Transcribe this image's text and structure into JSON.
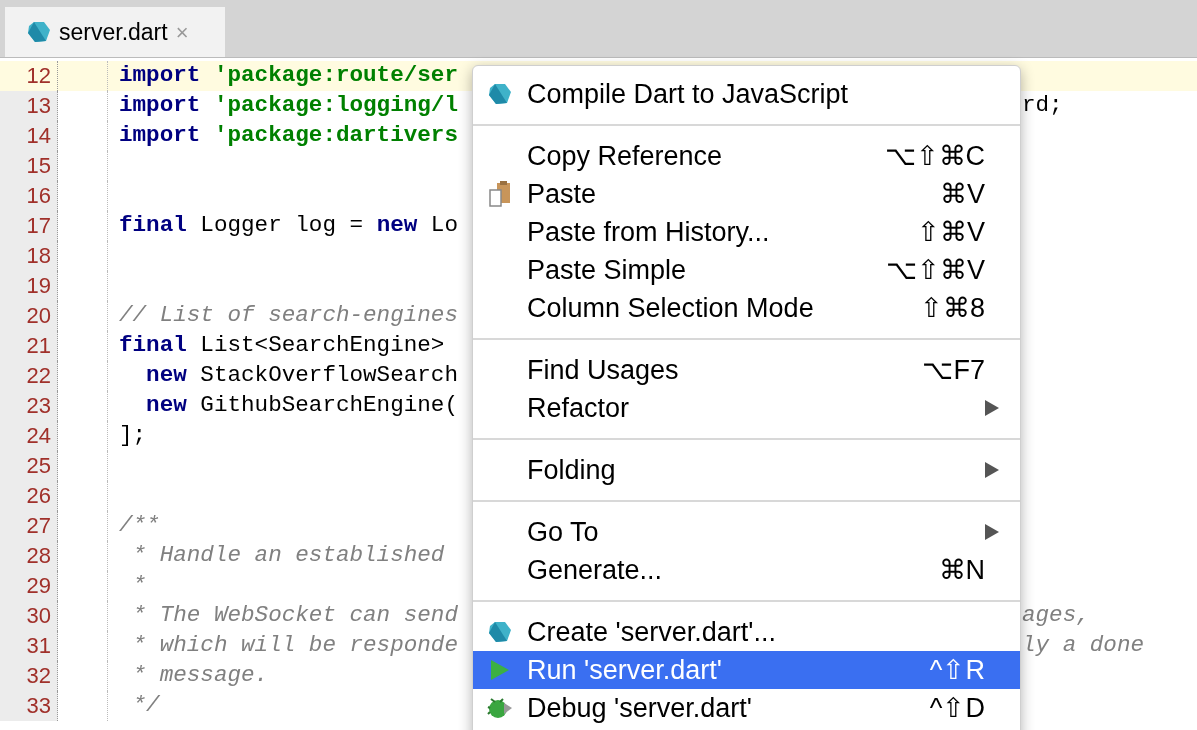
{
  "tabs": [
    {
      "label": "server.dart",
      "close": "×",
      "selected": true
    }
  ],
  "code": [
    {
      "number": "12",
      "current": true,
      "tokens": [
        {
          "kind": "keyword",
          "text": "import"
        },
        {
          "kind": "string",
          "text": " 'package:route/ser"
        }
      ]
    },
    {
      "number": "13",
      "current": false,
      "tokens": [
        {
          "kind": "keyword",
          "text": "import"
        },
        {
          "kind": "string",
          "text": " 'package:logging/l"
        }
      ],
      "right": [
        {
          "kind": "plain",
          "text": "rd;"
        }
      ]
    },
    {
      "number": "14",
      "current": false,
      "tokens": [
        {
          "kind": "keyword",
          "text": "import"
        },
        {
          "kind": "string",
          "text": " 'package:dartivers"
        }
      ]
    },
    {
      "number": "15",
      "current": false
    },
    {
      "number": "16",
      "current": false
    },
    {
      "number": "17",
      "current": false,
      "tokens": [
        {
          "kind": "keyword",
          "text": "final"
        },
        {
          "kind": "plain",
          "text": " Logger log = "
        },
        {
          "kind": "keyword",
          "text": "new"
        },
        {
          "kind": "plain",
          "text": " Lo"
        }
      ]
    },
    {
      "number": "18",
      "current": false
    },
    {
      "number": "19",
      "current": false
    },
    {
      "number": "20",
      "current": false,
      "tokens": [
        {
          "kind": "comment",
          "text": "// List of search-engines"
        }
      ]
    },
    {
      "number": "21",
      "current": false,
      "tokens": [
        {
          "kind": "keyword",
          "text": "final"
        },
        {
          "kind": "plain",
          "text": " List<SearchEngine>"
        }
      ]
    },
    {
      "number": "22",
      "current": false,
      "tokens": [
        {
          "kind": "keyword",
          "text": "  new"
        },
        {
          "kind": "plain",
          "text": " StackOverflowSearch"
        }
      ]
    },
    {
      "number": "23",
      "current": false,
      "tokens": [
        {
          "kind": "keyword",
          "text": "  new"
        },
        {
          "kind": "plain",
          "text": " GithubSearchEngine("
        }
      ]
    },
    {
      "number": "24",
      "current": false,
      "tokens": [
        {
          "kind": "plain",
          "text": "];"
        }
      ]
    },
    {
      "number": "25",
      "current": false
    },
    {
      "number": "26",
      "current": false
    },
    {
      "number": "27",
      "current": false,
      "tokens": [
        {
          "kind": "comment",
          "text": "/**"
        }
      ]
    },
    {
      "number": "28",
      "current": false,
      "tokens": [
        {
          "kind": "comment",
          "text": " * Handle an established"
        }
      ]
    },
    {
      "number": "29",
      "current": false,
      "tokens": [
        {
          "kind": "comment",
          "text": " *"
        }
      ]
    },
    {
      "number": "30",
      "current": false,
      "tokens": [
        {
          "kind": "comment",
          "text": " * The WebSocket can send"
        }
      ],
      "right": [
        {
          "kind": "comment",
          "text": "ages,"
        }
      ]
    },
    {
      "number": "31",
      "current": false,
      "tokens": [
        {
          "kind": "comment",
          "text": " * which will be responde"
        }
      ],
      "right": [
        {
          "kind": "comment",
          "text": "ly a done"
        }
      ]
    },
    {
      "number": "32",
      "current": false,
      "tokens": [
        {
          "kind": "comment",
          "text": " * message."
        }
      ]
    },
    {
      "number": "33",
      "current": false,
      "tokens": [
        {
          "kind": "comment",
          "text": " */"
        }
      ]
    }
  ],
  "context_menu": [
    {
      "kind": "dart",
      "label": "Compile Dart to JavaScript",
      "submenu": false,
      "selected": false
    },
    {
      "kind": "separator"
    },
    {
      "kind": "plain",
      "label": "Copy Reference",
      "shortcut": "⌥⇧⌘C",
      "submenu": false,
      "selected": false
    },
    {
      "kind": "paste",
      "label": "Paste",
      "shortcut": "⌘V",
      "submenu": false,
      "selected": false
    },
    {
      "kind": "plain",
      "label": "Paste from History...",
      "shortcut": "⇧⌘V",
      "submenu": false,
      "selected": false
    },
    {
      "kind": "plain",
      "label": "Paste Simple",
      "shortcut": "⌥⇧⌘V",
      "submenu": false,
      "selected": false
    },
    {
      "kind": "plain",
      "label": "Column Selection Mode",
      "shortcut": "⇧⌘8",
      "submenu": false,
      "selected": false
    },
    {
      "kind": "separator"
    },
    {
      "kind": "plain",
      "label": "Find Usages",
      "shortcut": "⌥F7",
      "submenu": false,
      "selected": false
    },
    {
      "kind": "plain",
      "label": "Refactor",
      "submenu": true,
      "selected": false
    },
    {
      "kind": "separator"
    },
    {
      "kind": "plain",
      "label": "Folding",
      "submenu": true,
      "selected": false
    },
    {
      "kind": "separator"
    },
    {
      "kind": "plain",
      "label": "Go To",
      "submenu": true,
      "selected": false
    },
    {
      "kind": "plain",
      "label": "Generate...",
      "shortcut": "⌘N",
      "submenu": false,
      "selected": false
    },
    {
      "kind": "separator"
    },
    {
      "kind": "dart",
      "label": "Create 'server.dart'...",
      "submenu": false,
      "selected": false
    },
    {
      "kind": "run",
      "label": "Run 'server.dart'",
      "shortcut": "^⇧R",
      "submenu": false,
      "selected": true
    },
    {
      "kind": "debug",
      "label": "Debug 'server.dart'",
      "shortcut": "^⇧D",
      "submenu": false,
      "selected": false
    }
  ]
}
